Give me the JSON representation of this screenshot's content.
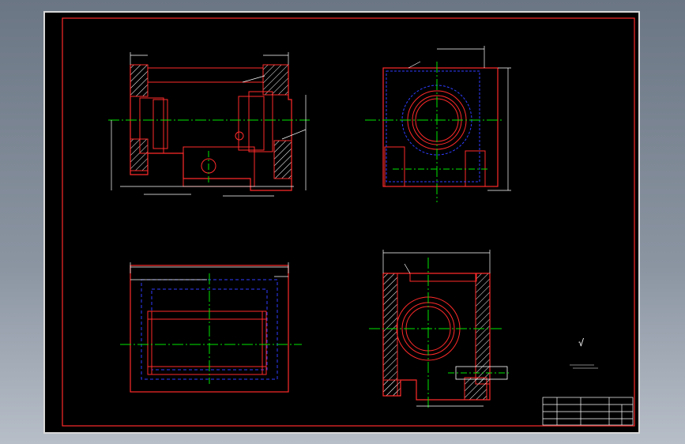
{
  "colors": {
    "background": "#000000",
    "frame": "#ffffff",
    "outline": "#ff2a2a",
    "hidden": "#2f3dff",
    "center": "#00e600",
    "dimension": "#ffffff",
    "hatch": "#ffffff"
  },
  "title_block": {
    "title": "",
    "scale": "",
    "sheet": ""
  },
  "notes": {
    "roughness": "√"
  }
}
